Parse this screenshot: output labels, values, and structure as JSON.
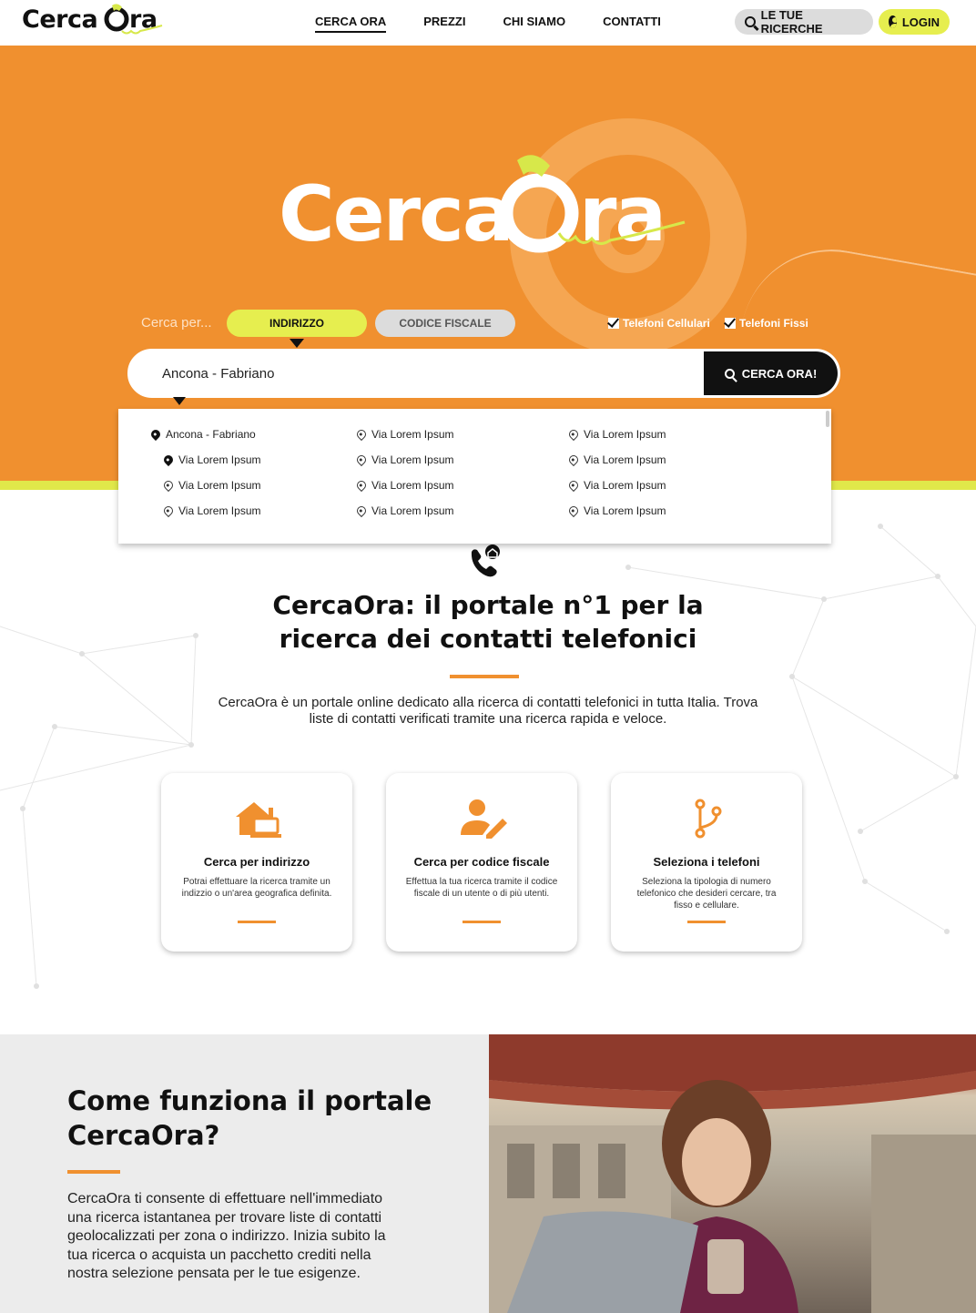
{
  "header": {
    "logo_text": "CercaOra",
    "nav": [
      "CERCA ORA",
      "PREZZI",
      "CHI SIAMO",
      "CONTATTI"
    ],
    "ricerche_label": "LE TUE RICERCHE",
    "login_label": "LOGIN"
  },
  "hero": {
    "logo_text": "CercaOra",
    "search_label": "Cerca per...",
    "tab_address": "INDIRIZZO",
    "tab_fiscal": "CODICE FISCALE",
    "check_mobile": "Telefoni Cellulari",
    "check_landline": "Telefoni Fissi",
    "search_value": "Ancona - Fabriano",
    "search_button": "CERCA ORA!"
  },
  "dropdown": {
    "col1": [
      "Ancona - Fabriano",
      "Via Lorem Ipsum",
      "Via Lorem Ipsum",
      "Via Lorem Ipsum"
    ],
    "col2": [
      "Via Lorem Ipsum",
      "Via Lorem Ipsum",
      "Via Lorem Ipsum",
      "Via Lorem Ipsum"
    ],
    "col3": [
      "Via Lorem Ipsum",
      "Via Lorem Ipsum",
      "Via Lorem Ipsum",
      "Via Lorem Ipsum"
    ]
  },
  "intro": {
    "title_line1": "CercaOra: il portale n°1 per la",
    "title_line2": "ricerca dei contatti telefonici",
    "text": "CercaOra è un portale online dedicato alla ricerca di contatti telefonici in tutta Italia. Trova liste di contatti verificati tramite una ricerca rapida e veloce."
  },
  "cards": [
    {
      "title": "Cerca per indirizzo",
      "text": "Potrai effettuare la ricerca tramite un indizzio o un'area geografica definita.",
      "icon": "home-laptop-icon"
    },
    {
      "title": "Cerca per codice fiscale",
      "text": "Effettua la tua ricerca tramite il codice fiscale di un utente o di più utenti.",
      "icon": "user-edit-icon"
    },
    {
      "title": "Seleziona i telefoni",
      "text": "Seleziona la tipologia di numero telefonico che desideri cercare, tra fisso e cellulare.",
      "icon": "branch-icon"
    }
  ],
  "how": {
    "title": "Come funziona il portale CercaOra?",
    "text": "CercaOra ti consente di effettuare nell'immediato una ricerca istantanea per trovare liste di contatti geolocalizzati per zona o indirizzo. Inizia subito la tua ricerca o acquista un pacchetto crediti nella nostra selezione pensata per le tue esigenze."
  },
  "colors": {
    "orange": "#f0902f",
    "lime": "#e6ee4f",
    "dark": "#111111",
    "grey": "#ececec"
  }
}
